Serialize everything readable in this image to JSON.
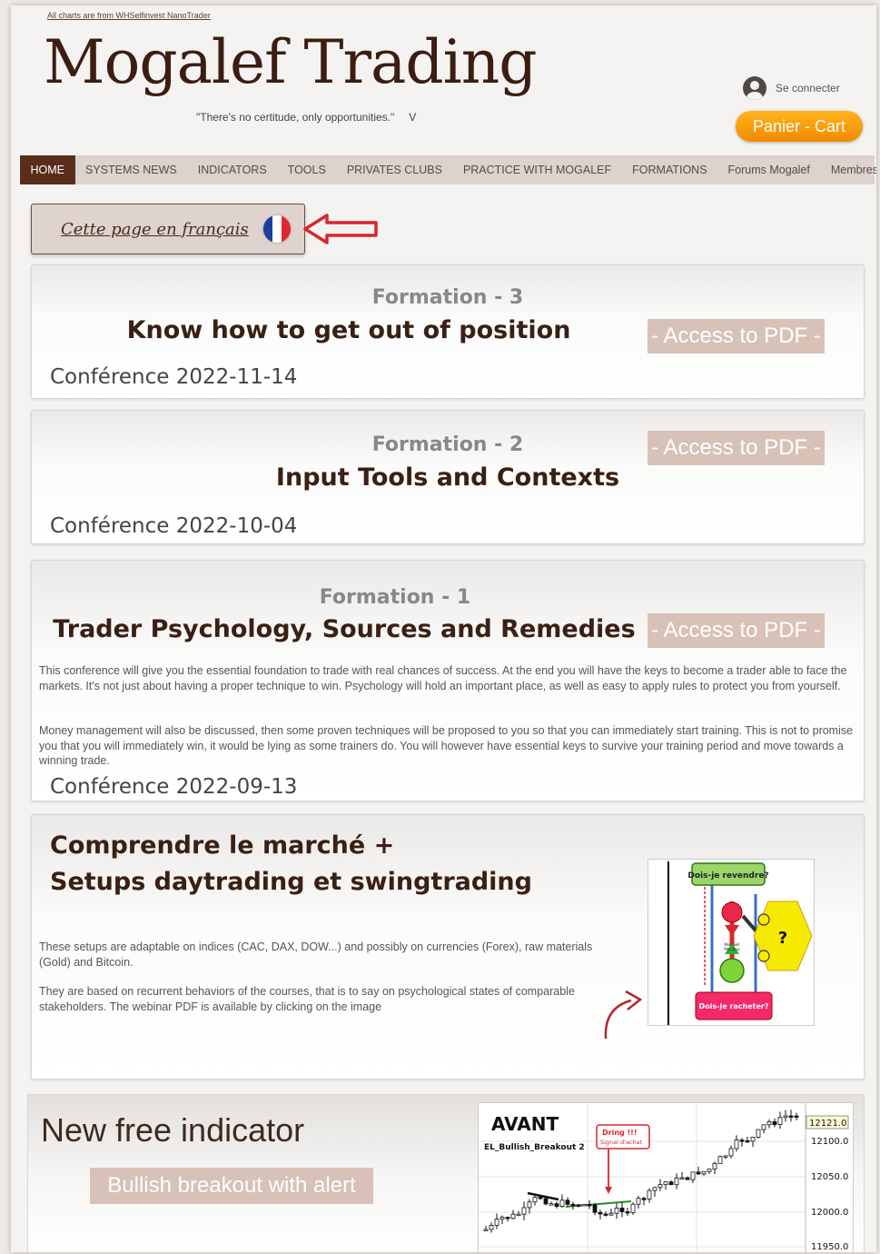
{
  "header": {
    "credit": "All charts are from WHSelfinvest NanoTrader",
    "logo": "Mogalef Trading",
    "tagline": "\"There's no certitude, only opportunities.\"",
    "tagline_suffix": "V",
    "login_label": "Se connecter",
    "cart_label": "Panier - Cart"
  },
  "nav": {
    "items": [
      "HOME",
      "SYSTEMS NEWS",
      "INDICATORS",
      "TOOLS",
      "PRIVATES CLUBS",
      "PRACTICE WITH MOGALEF",
      "FORMATIONS",
      "Forums Mogalef",
      "Membres"
    ],
    "active": "HOME"
  },
  "french_link": {
    "label": "Cette page en français"
  },
  "formations": [
    {
      "number": "Formation - 3",
      "title": "Know how to get out of position",
      "conference": "Conférence 2022-11-14",
      "pdf_label": "- Access to PDF -"
    },
    {
      "number": "Formation - 2",
      "title": "Input Tools and Contexts",
      "conference": "Conférence 2022-10-04",
      "pdf_label": "- Access to PDF -"
    },
    {
      "number": "Formation - 1",
      "title": "Trader Psychology, Sources and Remedies",
      "conference": "Conférence 2022-09-13",
      "pdf_label": "- Access to PDF -",
      "paragraph1": "This conference will give you the essential foundation to trade with real chances of success. At the end you will have the keys to become a trader able to face the markets. It's not just about having a proper technique to win. Psychology will hold an important place, as well as easy to apply rules to protect you from yourself.",
      "paragraph2": "Money management will also be discussed, then some proven techniques will be proposed to you so that you can immediately start training.  This is not to promise you that you will immediately win, it would be lying as some trainers do. You will however have essential keys to survive your training period and move towards a winning trade."
    }
  ],
  "setups": {
    "title_line1": "Comprendre le marché +",
    "title_line2": "Setups daytrading et swingtrading",
    "paragraph1": "These setups are adaptable on indices (CAC, DAX, DOW...) and possibly on currencies (Forex), raw materials (Gold) and Bitcoin.",
    "paragraph2": "They are based on recurrent behaviors of the courses, that is to say on psychological states of comparable stakeholders.  The webinar PDF is available by clicking on the image",
    "diagram": {
      "top_label": "Dois-je revendre?",
      "bottom_label": "Dois-je racheter?",
      "question": "?",
      "mid_label_1": "Mon Sell",
      "mid_label_2": "Mon Buy"
    }
  },
  "indicator": {
    "title": "New free indicator",
    "button_label": "Bullish breakout with alert",
    "chart": {
      "heading": "AVANT",
      "series_label": "EL_Bullish_Breakout 2",
      "alert_line1": "Dring !!!",
      "alert_line2": "Signal d'achat",
      "last_price": "12121.0",
      "y_ticks": [
        "12100.0",
        "12050.0",
        "12000.0",
        "11950.0"
      ]
    }
  },
  "colors": {
    "brand_dark": "#5a2d1a",
    "cart_orange": "#f28a00",
    "pdf_button": "#d8c1b7",
    "arrow_red": "#d9262e"
  }
}
